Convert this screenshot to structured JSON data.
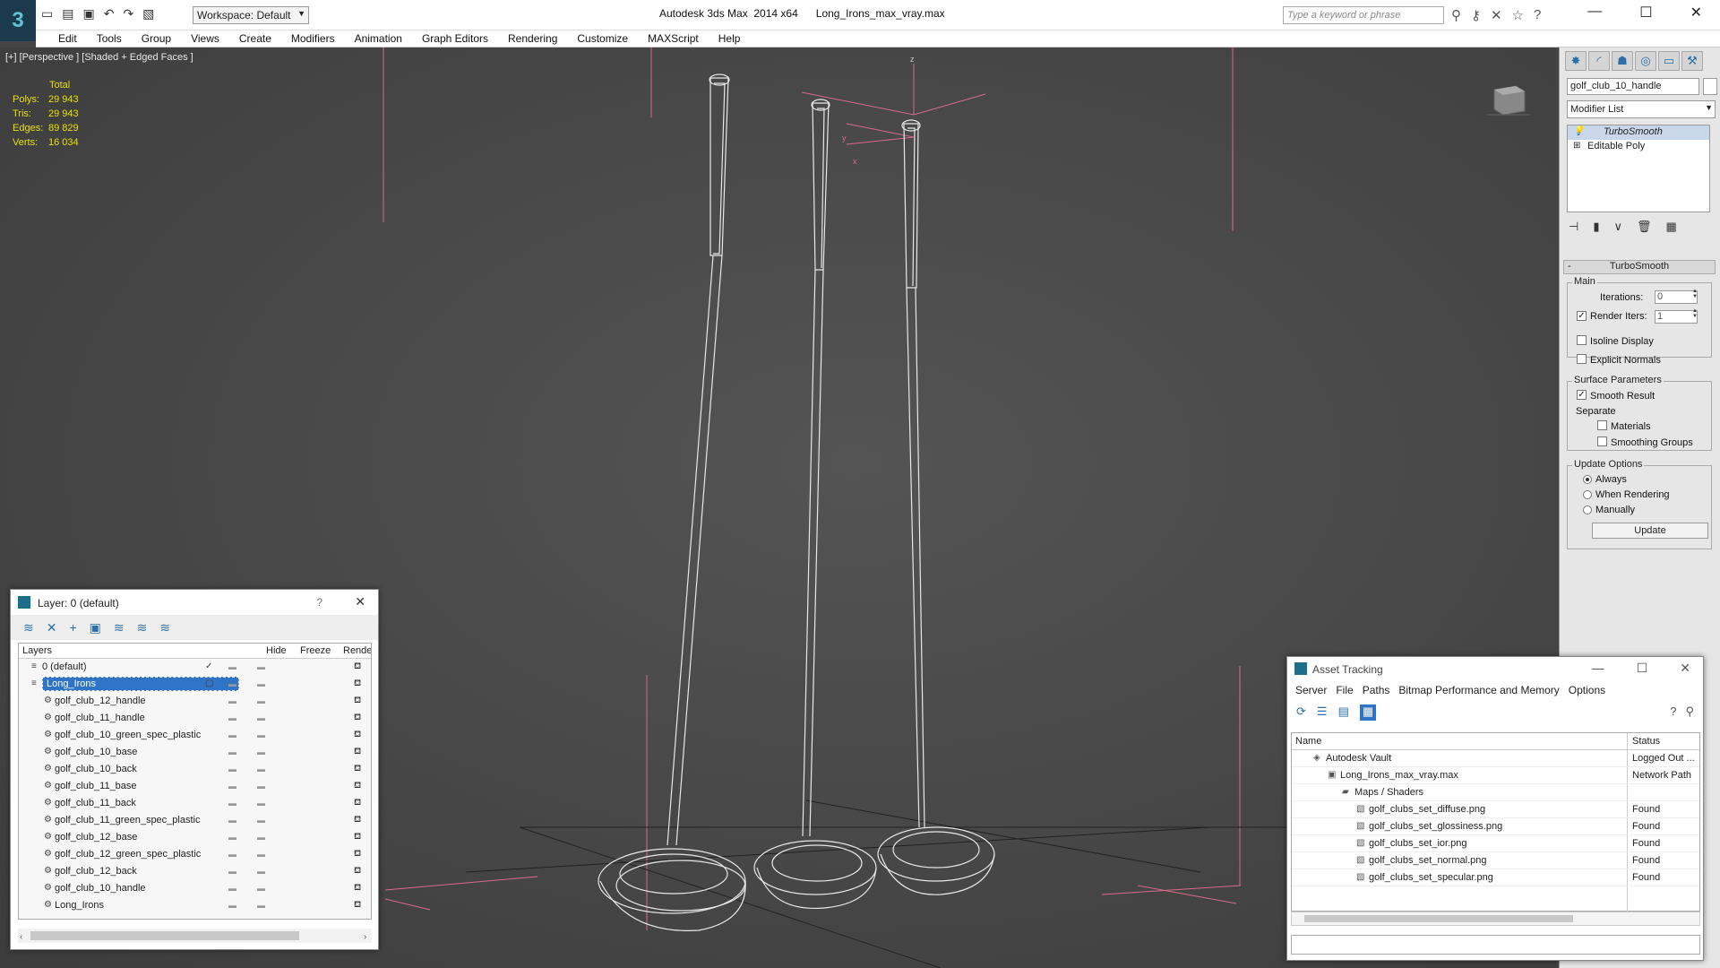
{
  "app": {
    "title": "Autodesk 3ds Max  2014 x64",
    "file": "Long_Irons_max_vray.max",
    "workspace": "Workspace: Default",
    "search_placeholder": "Type a keyword or phrase"
  },
  "menu": [
    "Edit",
    "Tools",
    "Group",
    "Views",
    "Create",
    "Modifiers",
    "Animation",
    "Graph Editors",
    "Rendering",
    "Customize",
    "MAXScript",
    "Help"
  ],
  "viewport": {
    "label": "[+] [Perspective ] [Shaded + Edged Faces ]",
    "stats": {
      "header": "Total",
      "rows": [
        {
          "k": "Polys:",
          "v": "29 943"
        },
        {
          "k": "Tris:",
          "v": "29 943"
        },
        {
          "k": "Edges:",
          "v": "89 829"
        },
        {
          "k": "Verts:",
          "v": "16 034"
        }
      ]
    },
    "axes": {
      "z": "z",
      "y": "y",
      "x": "x"
    }
  },
  "command_panel": {
    "object_name": "golf_club_10_handle",
    "modifier_list": "Modifier List",
    "stack": [
      "TurboSmooth",
      "Editable Poly"
    ],
    "rollout_title": "TurboSmooth",
    "main_group": "Main",
    "iterations_label": "Iterations:",
    "iterations_value": "0",
    "render_iters_label": "Render Iters:",
    "render_iters_value": "1",
    "isoline_label": "Isoline Display",
    "explicit_label": "Explicit Normals",
    "surface_group": "Surface Parameters",
    "smooth_result_label": "Smooth Result",
    "separate_label": "Separate",
    "materials_label": "Materials",
    "smoothing_label": "Smoothing Groups",
    "update_group": "Update Options",
    "always_label": "Always",
    "when_rendering_label": "When Rendering",
    "manually_label": "Manually",
    "update_button": "Update"
  },
  "layer_window": {
    "title": "Layer: 0 (default)",
    "help": "?",
    "columns": {
      "layers": "Layers",
      "hide": "Hide",
      "freeze": "Freeze",
      "render": "Rende"
    },
    "rows": [
      {
        "name": "0 (default)",
        "level": 0,
        "selected": false,
        "check": true
      },
      {
        "name": "Long_Irons",
        "level": 0,
        "selected": true,
        "check": false
      },
      {
        "name": "golf_club_12_handle",
        "level": 1
      },
      {
        "name": "golf_club_11_handle",
        "level": 1
      },
      {
        "name": "golf_club_10_green_spec_plastic",
        "level": 1
      },
      {
        "name": "golf_club_10_base",
        "level": 1
      },
      {
        "name": "golf_club_10_back",
        "level": 1
      },
      {
        "name": "golf_club_11_base",
        "level": 1
      },
      {
        "name": "golf_club_11_back",
        "level": 1
      },
      {
        "name": "golf_club_11_green_spec_plastic",
        "level": 1
      },
      {
        "name": "golf_club_12_base",
        "level": 1
      },
      {
        "name": "golf_club_12_green_spec_plastic",
        "level": 1
      },
      {
        "name": "golf_club_12_back",
        "level": 1
      },
      {
        "name": "golf_club_10_handle",
        "level": 1
      },
      {
        "name": "Long_Irons",
        "level": 1
      }
    ]
  },
  "asset_window": {
    "title": "Asset Tracking",
    "menu": [
      "Server",
      "File",
      "Paths",
      "Bitmap Performance and Memory",
      "Options"
    ],
    "columns": {
      "name": "Name",
      "status": "Status"
    },
    "rows": [
      {
        "name": "Autodesk Vault",
        "status": "Logged Out ...",
        "level": 1
      },
      {
        "name": "Long_Irons_max_vray.max",
        "status": "Network Path",
        "level": 2
      },
      {
        "name": "Maps / Shaders",
        "status": "",
        "level": 3
      },
      {
        "name": "golf_clubs_set_diffuse.png",
        "status": "Found",
        "level": 4
      },
      {
        "name": "golf_clubs_set_glossiness.png",
        "status": "Found",
        "level": 4
      },
      {
        "name": "golf_clubs_set_ior.png",
        "status": "Found",
        "level": 4
      },
      {
        "name": "golf_clubs_set_normal.png",
        "status": "Found",
        "level": 4
      },
      {
        "name": "golf_clubs_set_specular.png",
        "status": "Found",
        "level": 4
      }
    ]
  }
}
